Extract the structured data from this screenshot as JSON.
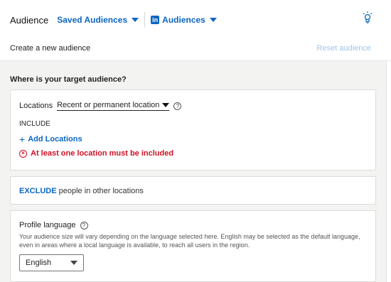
{
  "header": {
    "title": "Audience",
    "saved_audiences": "Saved Audiences",
    "li_logo": "in",
    "audiences": "Audiences",
    "bulb_icon": "lightbulb-icon"
  },
  "subheader": {
    "create_text": "Create a new audience",
    "reset": "Reset audience"
  },
  "targeting": {
    "question": "Where is your target audience?",
    "locations_label": "Locations",
    "location_type": "Recent or permanent location",
    "help_glyph": "?",
    "include_label": "INCLUDE",
    "add_plus": "+",
    "add_locations": "Add Locations",
    "error_glyph": "×",
    "error_text": "At least one location must be included",
    "exclude_link": "EXCLUDE",
    "exclude_text": " people in other locations"
  },
  "profile_language": {
    "title": "Profile language",
    "help_glyph": "?",
    "description": "Your audience size will vary depending on the language selected here. English may be selected as the default language, even in areas where a local language is available, to reach all users in the region.",
    "selected": "English"
  },
  "colors": {
    "accent": "#0a66c2",
    "error": "#d11124",
    "panel_bg": "#f3f3f2"
  }
}
